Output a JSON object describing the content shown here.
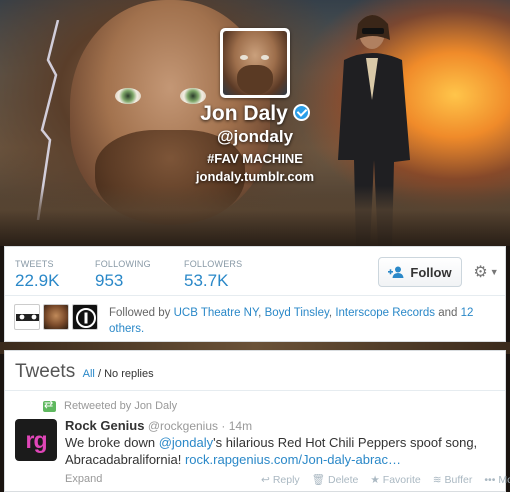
{
  "profile": {
    "name": "Jon Daly",
    "handle": "@jondaly",
    "bio": "#FAV MACHINE",
    "website": "jondaly.tumblr.com"
  },
  "stats": [
    {
      "label": "TWEETS",
      "value": "22.9K"
    },
    {
      "label": "FOLLOWING",
      "value": "953"
    },
    {
      "label": "FOLLOWERS",
      "value": "53.7K"
    }
  ],
  "actions": {
    "follow_label": "Follow"
  },
  "followed_by": {
    "prefix": "Followed by",
    "names": [
      "UCB Theatre NY",
      "Boyd Tinsley",
      "Interscope Records"
    ],
    "and_text": "and",
    "others_link": "12 others.",
    "thumb1_caption": "UCB THEATRE NEW YORK"
  },
  "tweets_section": {
    "title": "Tweets",
    "filter_all": "All",
    "filter_sep": "/",
    "filter_no_replies": "No replies"
  },
  "tweet": {
    "retweeted_by": "Retweeted by Jon Daly",
    "avatar_text": "rg",
    "author_name": "Rock Genius",
    "author_handle": "@rockgenius",
    "time": "14m",
    "text_part1": "We broke down ",
    "mention": "@jondaly",
    "text_part2": "'s hilarious Red Hot Chili Peppers spoof song, Abracadabralifornia! ",
    "link": "rock.rapgenius.com/Jon-daly-abrac…",
    "expand": "Expand",
    "action_reply": "Reply",
    "action_delete": "Delete",
    "action_favorite": "Favorite",
    "action_buffer": "Buffer",
    "action_more": "More"
  },
  "colors": {
    "link_blue": "#2a88c8",
    "verified_blue": "#2b9ee8",
    "retweet_green": "#5fb85f",
    "rg_pink": "#e046b8"
  }
}
